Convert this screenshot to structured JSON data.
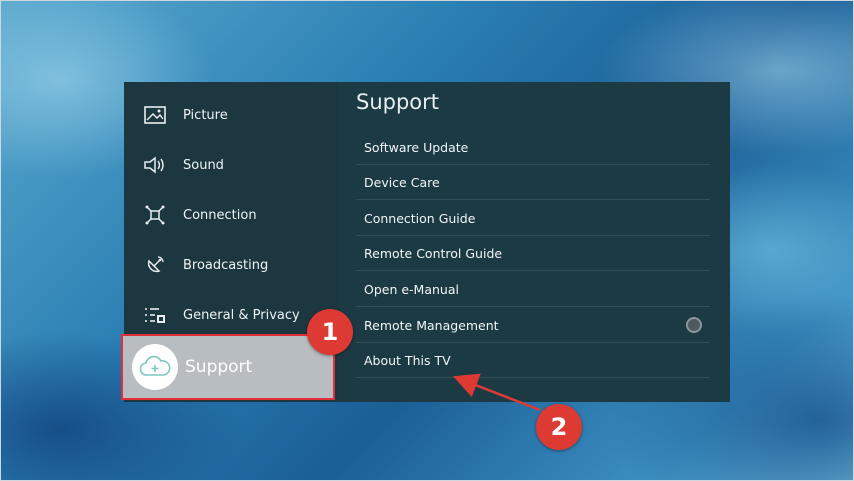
{
  "nav": {
    "items": [
      {
        "label": "Picture",
        "icon": "picture-icon"
      },
      {
        "label": "Sound",
        "icon": "sound-icon"
      },
      {
        "label": "Connection",
        "icon": "connection-icon"
      },
      {
        "label": "Broadcasting",
        "icon": "broadcasting-icon"
      },
      {
        "label": "General & Privacy",
        "icon": "general-privacy-icon"
      }
    ],
    "selected": {
      "label": "Support",
      "icon": "support-cloud-icon"
    }
  },
  "panel": {
    "title": "Support",
    "items": [
      {
        "label": "Software Update"
      },
      {
        "label": "Device Care"
      },
      {
        "label": "Connection Guide"
      },
      {
        "label": "Remote Control Guide"
      },
      {
        "label": "Open e-Manual"
      },
      {
        "label": "Remote Management",
        "has_toggle": true
      },
      {
        "label": "About This TV"
      }
    ]
  },
  "annotations": {
    "step1": "1",
    "step2": "2",
    "color": "#dd3a33"
  }
}
